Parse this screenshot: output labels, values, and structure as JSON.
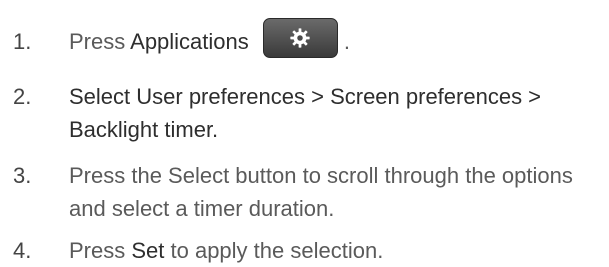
{
  "steps": [
    {
      "number": "1.",
      "parts": [
        "Press ",
        "Applications",
        "."
      ],
      "button_icon": "gear-icon"
    },
    {
      "number": "2.",
      "lines": [
        "Select User preferences > Screen preferences >",
        "Backlight timer."
      ]
    },
    {
      "number": "3.",
      "lines": [
        "Press the Select button to scroll through the options",
        "and select a timer duration."
      ]
    },
    {
      "number": "4.",
      "parts": [
        "Press ",
        "Set",
        " to apply the selection."
      ]
    }
  ],
  "colors": {
    "text": "#5a5a5a",
    "emphasis": "#2e2e2e",
    "button_bg": "#4a4a4a"
  }
}
